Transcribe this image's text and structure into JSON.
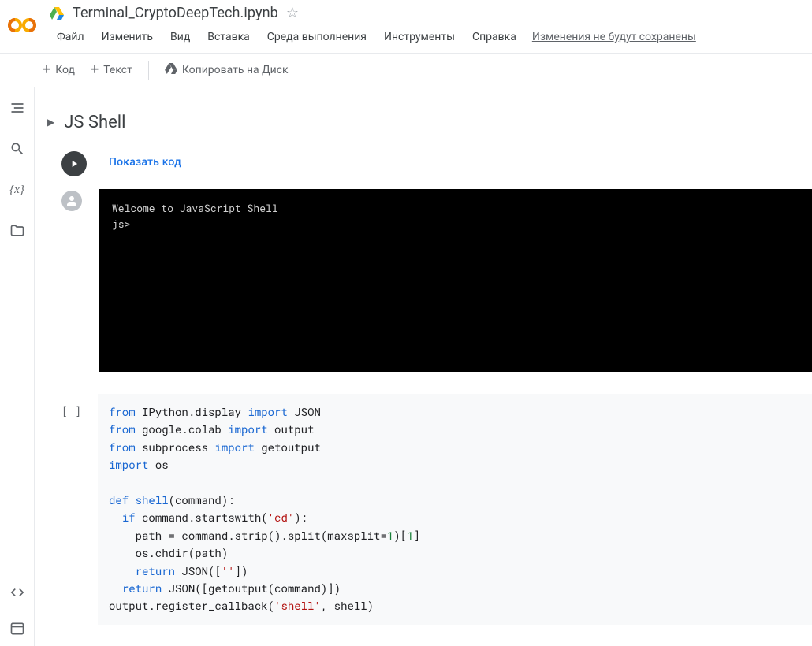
{
  "header": {
    "doc_title": "Terminal_CryptoDeepTech.ipynb"
  },
  "menu": {
    "file": "Файл",
    "edit": "Изменить",
    "view": "Вид",
    "insert": "Вставка",
    "runtime": "Среда выполнения",
    "tools": "Инструменты",
    "help": "Справка",
    "status": "Изменения не будут сохранены"
  },
  "toolbar": {
    "code": "Код",
    "text": "Текст",
    "copy_drive": "Копировать на Диск"
  },
  "section": {
    "title": "JS Shell"
  },
  "cell1": {
    "show_code": "Показать код"
  },
  "terminal": {
    "line1": "Welcome to JavaScript Shell",
    "line2": "js>"
  },
  "cell2": {
    "gutter": "[ ]",
    "code_tokens": [
      [
        {
          "t": "kw",
          "v": "from"
        },
        {
          "t": "id",
          "v": " IPython.display "
        },
        {
          "t": "kw",
          "v": "import"
        },
        {
          "t": "id",
          "v": " JSON"
        }
      ],
      [
        {
          "t": "kw",
          "v": "from"
        },
        {
          "t": "id",
          "v": " google.colab "
        },
        {
          "t": "kw",
          "v": "import"
        },
        {
          "t": "id",
          "v": " output"
        }
      ],
      [
        {
          "t": "kw",
          "v": "from"
        },
        {
          "t": "id",
          "v": " subprocess "
        },
        {
          "t": "kw",
          "v": "import"
        },
        {
          "t": "id",
          "v": " getoutput"
        }
      ],
      [
        {
          "t": "kw",
          "v": "import"
        },
        {
          "t": "id",
          "v": " os"
        }
      ],
      [],
      [
        {
          "t": "kw",
          "v": "def "
        },
        {
          "t": "fn",
          "v": "shell"
        },
        {
          "t": "op",
          "v": "(command):"
        }
      ],
      [
        {
          "t": "id",
          "v": "  "
        },
        {
          "t": "kw",
          "v": "if"
        },
        {
          "t": "id",
          "v": " command.startswith("
        },
        {
          "t": "str",
          "v": "'cd'"
        },
        {
          "t": "id",
          "v": "):"
        }
      ],
      [
        {
          "t": "id",
          "v": "    path = command.strip().split(maxsplit="
        },
        {
          "t": "num",
          "v": "1"
        },
        {
          "t": "id",
          "v": ")["
        },
        {
          "t": "num",
          "v": "1"
        },
        {
          "t": "id",
          "v": "]"
        }
      ],
      [
        {
          "t": "id",
          "v": "    os.chdir(path)"
        }
      ],
      [
        {
          "t": "id",
          "v": "    "
        },
        {
          "t": "kw",
          "v": "return"
        },
        {
          "t": "id",
          "v": " JSON(["
        },
        {
          "t": "str",
          "v": "''"
        },
        {
          "t": "id",
          "v": "])"
        }
      ],
      [
        {
          "t": "id",
          "v": "  "
        },
        {
          "t": "kw",
          "v": "return"
        },
        {
          "t": "id",
          "v": " JSON([getoutput(command)])"
        }
      ],
      [
        {
          "t": "id",
          "v": "output.register_callback("
        },
        {
          "t": "str",
          "v": "'shell'"
        },
        {
          "t": "id",
          "v": ", shell)"
        }
      ]
    ]
  }
}
